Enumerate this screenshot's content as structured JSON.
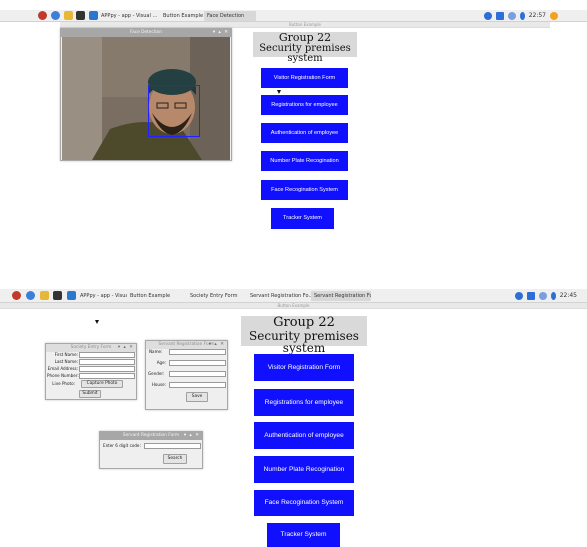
{
  "top_screen": {
    "taskbar": {
      "tasks": [
        {
          "label": "APPpy - app - Visual ..."
        },
        {
          "label": "Button Example"
        },
        {
          "label": "Face Detection",
          "active": true
        }
      ],
      "tray": {
        "clock": "22:57"
      }
    },
    "strip_title": "Button Example",
    "face_window": {
      "title": "Face Detection",
      "controls": "▾ ▴ ✕"
    },
    "app": {
      "heading_line1": "Group 22",
      "heading_line2": "Security premises system",
      "buttons": [
        "Visitor Registration Form",
        "Registrations for employee",
        "Authentication of employee",
        "Number Plate Recogination",
        "Face Recogination System",
        "Tracker System"
      ]
    }
  },
  "bottom_screen": {
    "taskbar": {
      "tasks": [
        {
          "label": "APPpy - app - Visual ..."
        },
        {
          "label": "Button Example"
        },
        {
          "label": "Society Entry Form"
        },
        {
          "label": "Servant Registration Fo..."
        },
        {
          "label": "Servant Registration Fo...",
          "active": true
        }
      ],
      "tray": {
        "clock": "22:45"
      }
    },
    "strip_title": "Button Example",
    "society_form": {
      "title": "Society Entry Form",
      "controls": "▾ ▴ ✕",
      "labels": [
        "First Name:",
        "Last Name:",
        "Email Address:",
        "Phone Number:",
        "Live Photo:"
      ],
      "capture_button": "Capture Photo",
      "submit_button": "Submit"
    },
    "servant_form": {
      "title": "Servant Registration Form",
      "controls": "▾ ▴ ✕",
      "labels": [
        "Name:",
        "Age:",
        "Gender:",
        "House:"
      ],
      "save_button": "Save"
    },
    "search_form": {
      "title": "Servant Registration Form",
      "controls": "▾ ▴ ✕",
      "label": "Enter 6 digit code:",
      "search_button": "Search"
    },
    "app": {
      "heading_line1": "Group 22",
      "heading_line2": "Security premises system",
      "buttons": [
        "Visitor Registration Form",
        "Registrations for employee",
        "Authentication of employee",
        "Number Plate Recogination",
        "Face Recogination System",
        "Tracker System"
      ]
    }
  },
  "colors": {
    "button_blue": "#1010ff",
    "face_box": "#2222ff",
    "taskbar": "#efefef"
  }
}
